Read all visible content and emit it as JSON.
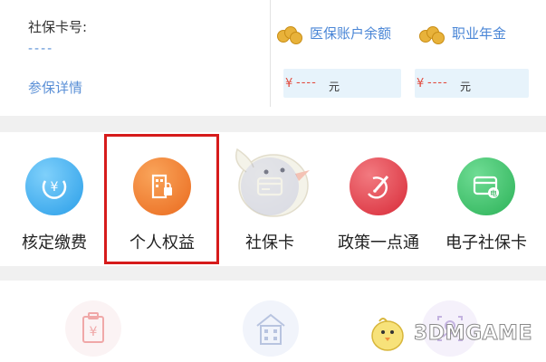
{
  "card": {
    "label": "社保卡号:",
    "number": "----",
    "detail_link": "参保详情"
  },
  "accounts": [
    {
      "label": "医保账户余额",
      "symbol": "¥",
      "amount": "----",
      "unit": "元"
    },
    {
      "label": "职业年金",
      "symbol": "¥",
      "amount": "----",
      "unit": "元"
    }
  ],
  "menu": [
    {
      "label": "核定缴费",
      "icon": "yen-coin-icon",
      "color": "#3db0f0"
    },
    {
      "label": "个人权益",
      "icon": "building-lock-icon",
      "color": "#f07a2a"
    },
    {
      "label": "社保卡",
      "icon": "card-icon",
      "color": "#5a6fe0"
    },
    {
      "label": "政策一点通",
      "icon": "pen-icon",
      "color": "#e43a47"
    },
    {
      "label": "电子社保卡",
      "icon": "e-card-icon",
      "color": "#3cc06a"
    }
  ],
  "watermark": {
    "text": "3DMGAME"
  },
  "colors": {
    "highlight": "#d61b1b",
    "link": "#5a8fd6"
  }
}
